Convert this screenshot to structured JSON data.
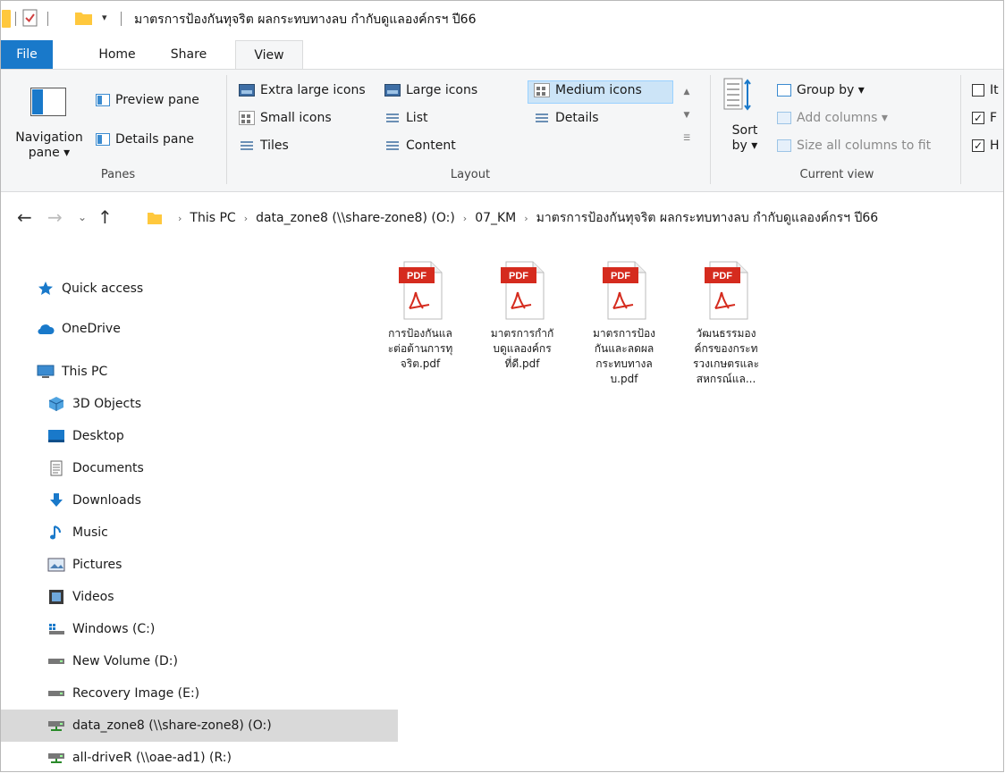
{
  "window": {
    "title": "มาตรการป้องกันทุจริต ผลกระทบทางลบ กำกับดูแลองค์กรฯ ปี66"
  },
  "tabs": [
    {
      "label": "File"
    },
    {
      "label": "Home"
    },
    {
      "label": "Share"
    },
    {
      "label": "View"
    }
  ],
  "ribbon": {
    "panes": {
      "navigation_pane": "Navigation pane ▾",
      "preview_pane": "Preview pane",
      "details_pane": "Details pane",
      "label": "Panes"
    },
    "layout": {
      "extra_large": "Extra large icons",
      "large": "Large icons",
      "medium": "Medium icons",
      "small": "Small icons",
      "list": "List",
      "details": "Details",
      "tiles": "Tiles",
      "content": "Content",
      "label": "Layout"
    },
    "current_view": {
      "sort_by": "Sort by ▾",
      "group_by": "Group by ▾",
      "add_columns": "Add columns ▾",
      "size_columns": "Size all columns to fit",
      "label": "Current view"
    },
    "show_hide": {
      "item_checkboxes": "It",
      "file_name_extensions": "F",
      "hidden_items": "H"
    }
  },
  "address": {
    "crumbs": [
      "This PC",
      "data_zone8 (\\\\share-zone8) (O:)",
      "07_KM",
      "มาตรการป้องกันทุจริต ผลกระทบทางลบ กำกับดูแลองค์กรฯ ปี66"
    ]
  },
  "nav": {
    "quick_access": "Quick access",
    "onedrive": "OneDrive",
    "this_pc": "This PC",
    "objects3d": "3D Objects",
    "desktop": "Desktop",
    "documents": "Documents",
    "downloads": "Downloads",
    "music": "Music",
    "pictures": "Pictures",
    "videos": "Videos",
    "windows_c": "Windows (C:)",
    "new_volume_d": "New Volume (D:)",
    "recovery_e": "Recovery Image (E:)",
    "data_zone8": "data_zone8 (\\\\share-zone8) (O:)",
    "all_driver": "all-driveR (\\\\oae-ad1) (R:)"
  },
  "files": [
    {
      "lines": [
        "การป้องกันแล",
        "ะต่อต้านการทุ",
        "จริต.pdf"
      ]
    },
    {
      "lines": [
        "มาตรการกำกั",
        "บดูแลองค์กร",
        "ที่ดี.pdf"
      ]
    },
    {
      "lines": [
        "มาตรการป้อง",
        "กันและลดผล",
        "กระทบทางล",
        "บ.pdf"
      ]
    },
    {
      "lines": [
        "วัฒนธรรมอง",
        "ค์กรของกระท",
        "รวงเกษตรและ",
        "สหกรณ์แล..."
      ]
    }
  ],
  "pdf_badge": "PDF",
  "colors": {
    "accent": "#1979ca",
    "pdf_red": "#d52b1e",
    "folder_yellow": "#ffc83d",
    "selection": "#cce4f7"
  }
}
